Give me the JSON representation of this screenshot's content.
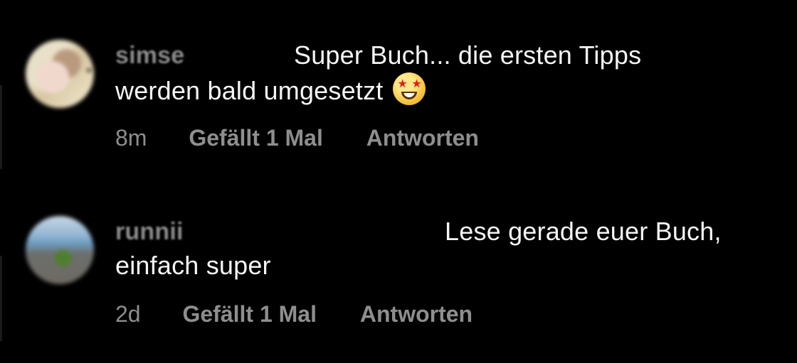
{
  "comments": [
    {
      "username": "simse",
      "text_first_line": "Super Buch... die ersten Tipps",
      "text_second_line": "werden bald umgesetzt",
      "emoji_icon": "star-struck-emoji",
      "time": "8m",
      "likes": "Gefällt 1 Mal",
      "reply": "Antworten"
    },
    {
      "username": "runnii",
      "text_first_line": "Lese gerade euer Buch,",
      "text_second_line": "einfach super",
      "time": "2d",
      "likes": "Gefällt 1 Mal",
      "reply": "Antworten"
    }
  ],
  "colors": {
    "background": "#000000",
    "primary_text": "#f5f5f5",
    "secondary_text": "#8e8e8e"
  }
}
